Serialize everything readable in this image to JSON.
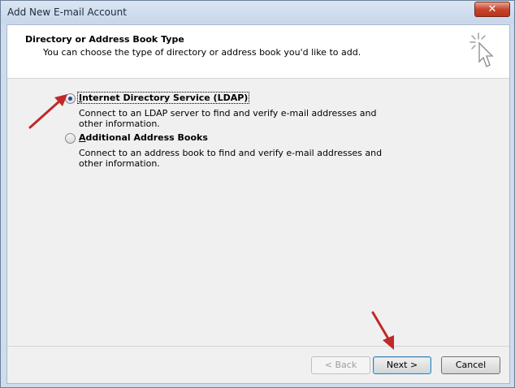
{
  "window": {
    "title": "Add New E-mail Account",
    "close_glyph": "✕"
  },
  "header": {
    "title": "Directory or Address Book Type",
    "subtitle": "You can choose the type of directory or address book you'd like to add."
  },
  "options": [
    {
      "label": "Internet Directory Service (LDAP)",
      "accel": "I",
      "description": "Connect to an LDAP server to find and verify e-mail addresses and other information.",
      "selected": true
    },
    {
      "label": "Additional Address Books",
      "accel": "A",
      "description": "Connect to an address book to find and verify e-mail addresses and other information.",
      "selected": false
    }
  ],
  "buttons": {
    "back": "< Back",
    "next": "Next >",
    "cancel": "Cancel"
  },
  "colors": {
    "annotation_arrow": "#c0282a",
    "radio_dot": "#1f4f91"
  }
}
